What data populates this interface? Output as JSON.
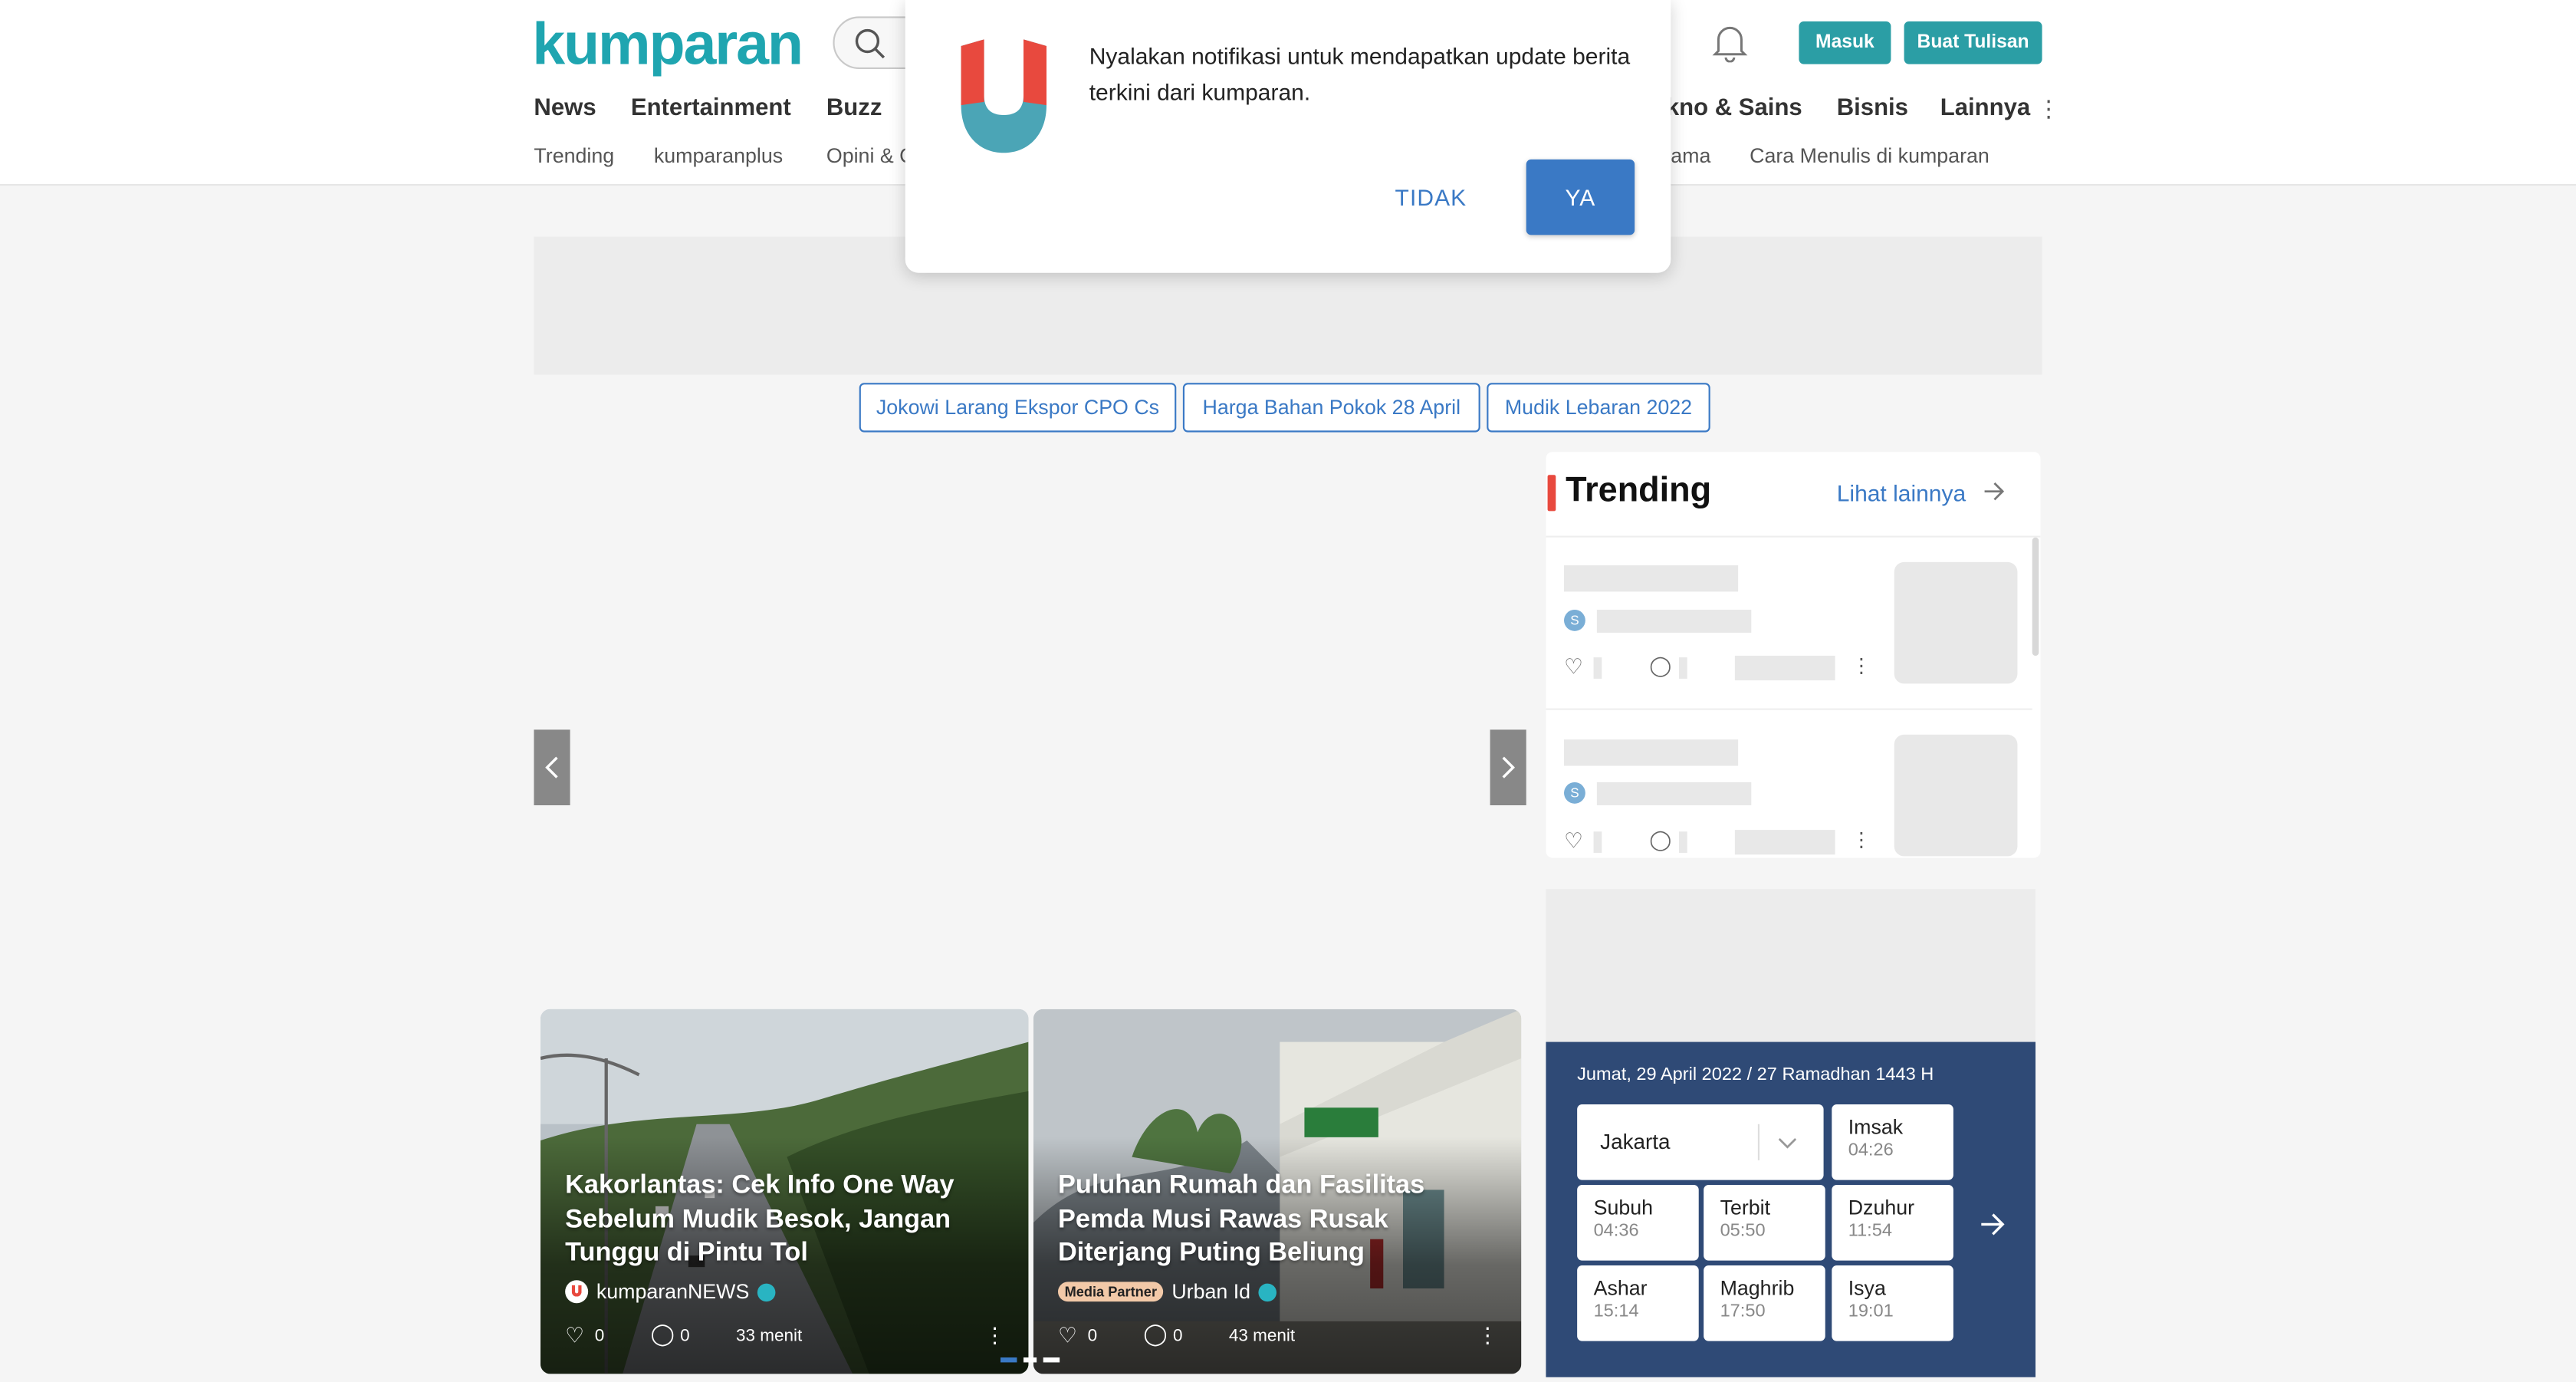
{
  "header": {
    "logo": "kumparan",
    "login_label": "Masuk",
    "write_label": "Buat Tulisan",
    "nav": [
      "News",
      "Entertainment",
      "Buzz",
      "kno & Sains",
      "Bisnis",
      "Lainnya"
    ],
    "subnav": [
      "Trending",
      "kumparanplus",
      "Opini & C",
      "ama",
      "Cara Menulis di kumparan"
    ]
  },
  "notification": {
    "message": "Nyalakan notifikasi untuk mendapatkan update berita terkini dari kumparan.",
    "decline_label": "TIDAK",
    "accept_label": "YA"
  },
  "topics": [
    "Jokowi Larang Ekspor CPO Cs",
    "Harga Bahan Pokok 28 April",
    "Mudik Lebaran 2022"
  ],
  "carousel": {
    "cards": [
      {
        "title": "Kakorlantas: Cek Info One Way Sebelum Mudik Besok, Jangan Tunggu di Pintu Tol",
        "source": "kumparanNEWS",
        "badge": "",
        "likes": "0",
        "comments": "0",
        "time": "33 menit"
      },
      {
        "title": "Puluhan Rumah dan Fasilitas Pemda Musi Rawas Rusak Diterjang Puting Beliung",
        "source": "Urban Id",
        "badge": "Media Partner",
        "likes": "0",
        "comments": "0",
        "time": "43 menit"
      }
    ]
  },
  "trending": {
    "title": "Trending",
    "more_label": "Lihat lainnya"
  },
  "prayer": {
    "date": "Jumat, 29 April 2022 / 27 Ramadhan 1443 H",
    "city": "Jakarta",
    "times": [
      {
        "name": "Imsak",
        "time": "04:26"
      },
      {
        "name": "Subuh",
        "time": "04:36"
      },
      {
        "name": "Terbit",
        "time": "05:50"
      },
      {
        "name": "Dzuhur",
        "time": "11:54"
      },
      {
        "name": "Ashar",
        "time": "15:14"
      },
      {
        "name": "Maghrib",
        "time": "17:50"
      },
      {
        "name": "Isya",
        "time": "19:01"
      }
    ]
  },
  "colors": {
    "brand_teal": "#2b9ea5",
    "link_blue": "#3a79c5",
    "accent_red": "#e8493e",
    "prayer_bg": "#2f4a76"
  }
}
